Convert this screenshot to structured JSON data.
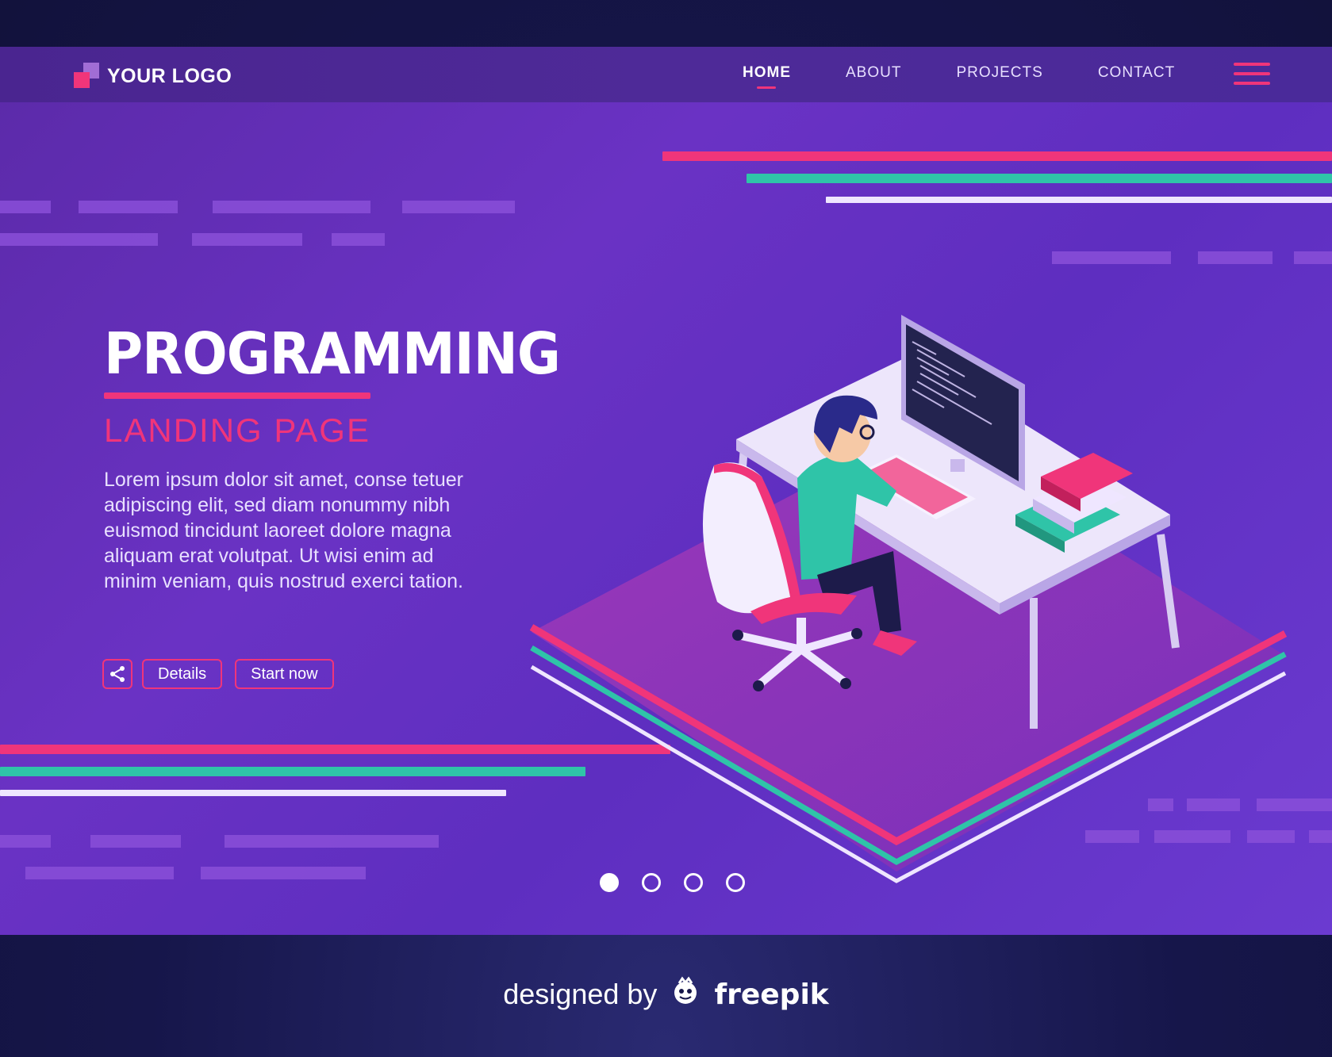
{
  "navbar": {
    "logo_text": "YOUR LOGO",
    "items": [
      {
        "label": "HOME",
        "active": true
      },
      {
        "label": "ABOUT",
        "active": false
      },
      {
        "label": "PROJECTS",
        "active": false
      },
      {
        "label": "CONTACT",
        "active": false
      }
    ],
    "menu_icon": "hamburger-icon"
  },
  "hero": {
    "title": "PROGRAMMING",
    "subtitle": "LANDING PAGE",
    "body": "Lorem ipsum dolor sit amet, conse tetuer adipiscing elit, sed diam nonummy nibh euismod tincidunt laoreet dolore magna aliquam erat volutpat. Ut wisi enim ad minim veniam, quis nostrud exerci tation.",
    "share_icon": "share-icon",
    "details_label": "Details",
    "start_label": "Start now"
  },
  "carousel": {
    "slide_count": 4,
    "active_index": 0
  },
  "credit": {
    "prefix": "designed by",
    "brand": "freepik"
  },
  "colors": {
    "accent_pink": "#f0357a",
    "accent_teal": "#2fc4a8",
    "background_purple": "#6a32c4",
    "outer_navy": "#16164a"
  }
}
